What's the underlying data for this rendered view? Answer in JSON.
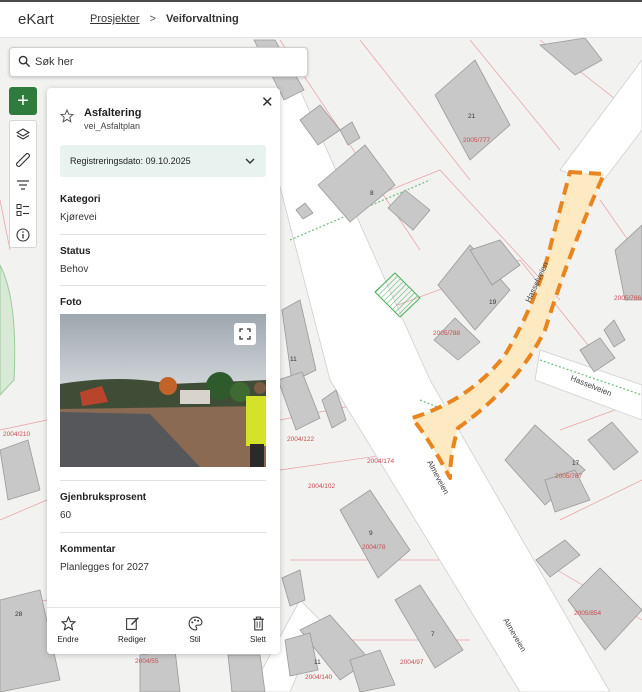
{
  "app": {
    "logo": "eKart"
  },
  "breadcrumb": {
    "projects": "Prosjekter",
    "current": "Veiforvaltning"
  },
  "search": {
    "placeholder": "Søk her"
  },
  "tools": [
    "layers-icon",
    "ruler-icon",
    "filter-icon",
    "legend-icon",
    "info-icon"
  ],
  "panel": {
    "title": "Asfaltering",
    "subtitle": "vei_Asfaltplan",
    "registration": "Registreringsdato:",
    "registration_date": "09.10.2025",
    "fields": {
      "category_label": "Kategori",
      "category_value": "Kjørevei",
      "status_label": "Status",
      "status_value": "Behov",
      "photo_label": "Foto",
      "reuse_label": "Gjenbruksprosent",
      "reuse_value": "60",
      "comment_label": "Kommentar",
      "comment_value": "Planlegges for 2027"
    },
    "actions": {
      "edit_shape": "Endre",
      "edit": "Rediger",
      "style": "Stil",
      "delete": "Slett"
    }
  },
  "map": {
    "streets": {
      "hasselveien_1": "Hasselveien",
      "hasselveien_2": "Hasselveien",
      "almeveien_1": "Almeveien",
      "almeveien_2": "Almeveien"
    },
    "parcels": {
      "p1": "2005/777",
      "p2": "2005/788",
      "p3": "2005/787",
      "p4": "2005/786",
      "p5": "2004/210",
      "p6": "2004/122",
      "p7": "2004/174",
      "p8": "2004/102",
      "p9": "2004/78",
      "p10": "2005/854",
      "p11": "2004/97",
      "p12": "2004/55",
      "p13": "2004/140"
    },
    "house_numbers": {
      "h1": "21",
      "h2": "8",
      "h3": "19",
      "h4": "11",
      "h5": "17",
      "h6": "9",
      "h7": "7",
      "h8": "11",
      "h9": "28"
    },
    "colors": {
      "highlight_stroke": "#e8851f",
      "highlight_fill": "#fde9c2",
      "brand_green": "#2f7b3d",
      "building": "#c8c8c8"
    }
  }
}
